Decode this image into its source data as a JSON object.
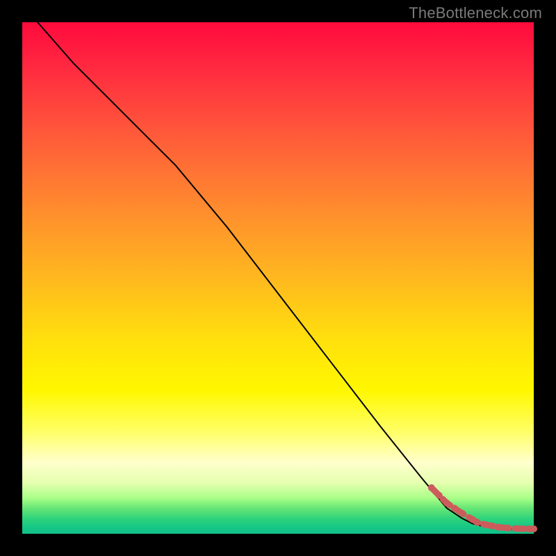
{
  "watermark": "TheBottleneck.com",
  "chart_data": {
    "type": "line",
    "title": "",
    "xlabel": "",
    "ylabel": "",
    "xlim": [
      0,
      100
    ],
    "ylim": [
      0,
      100
    ],
    "grid": false,
    "background_gradient": [
      "#ff0a3c",
      "#ffe00d",
      "#ffff66",
      "#10c088"
    ],
    "series": [
      {
        "name": "curve",
        "style": "solid-black",
        "x": [
          3,
          10,
          18,
          24,
          30,
          40,
          50,
          60,
          70,
          78,
          83,
          86,
          88,
          90,
          92,
          94,
          96,
          98,
          100
        ],
        "y": [
          100,
          92,
          84,
          78,
          72,
          60,
          47,
          34,
          21,
          11,
          5,
          3,
          2,
          1.5,
          1.2,
          1.0,
          0.9,
          0.9,
          0.9
        ]
      },
      {
        "name": "highlight-dots",
        "style": "dash-red-dots",
        "x": [
          80,
          81.5,
          83,
          84.5,
          86,
          88,
          89,
          90.5,
          92,
          93,
          95,
          97,
          99,
          100
        ],
        "y": [
          9,
          7.5,
          6,
          5,
          4,
          2.8,
          2.2,
          1.8,
          1.5,
          1.3,
          1.1,
          1.0,
          0.95,
          0.95
        ]
      }
    ]
  }
}
